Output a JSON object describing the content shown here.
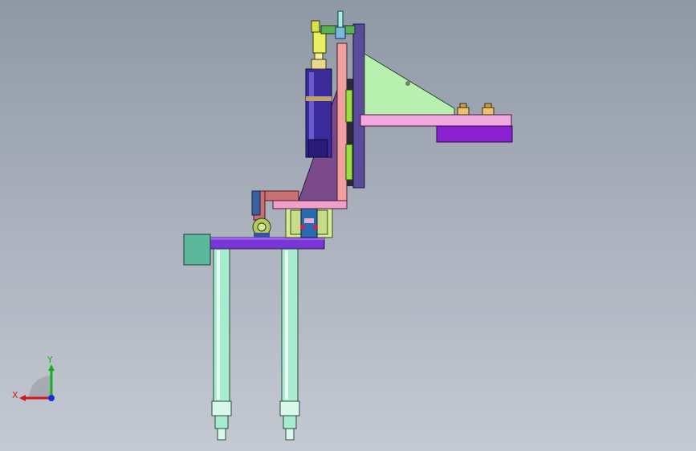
{
  "viewport": {
    "background_top": "#8f98a6",
    "background_bottom": "#c4c9d2"
  },
  "triad": {
    "x_label": "X",
    "y_label": "Y",
    "x_color": "#d01818",
    "y_color": "#18b018",
    "z_color": "#1830d0"
  },
  "model": {
    "colors": {
      "base_plate": "#7a35d6",
      "bracket_pink": "#f0a0c8",
      "gusset_green": "#b8f0b0",
      "gusset_purple": "#7a4a8a",
      "cylinder_blue": "#3a2a9a",
      "leg_green": "#a8ecd0",
      "block_teal": "#5cb89a",
      "vertical_plate": "#5a4a9a",
      "yellow_parts": "#e8e070"
    }
  }
}
